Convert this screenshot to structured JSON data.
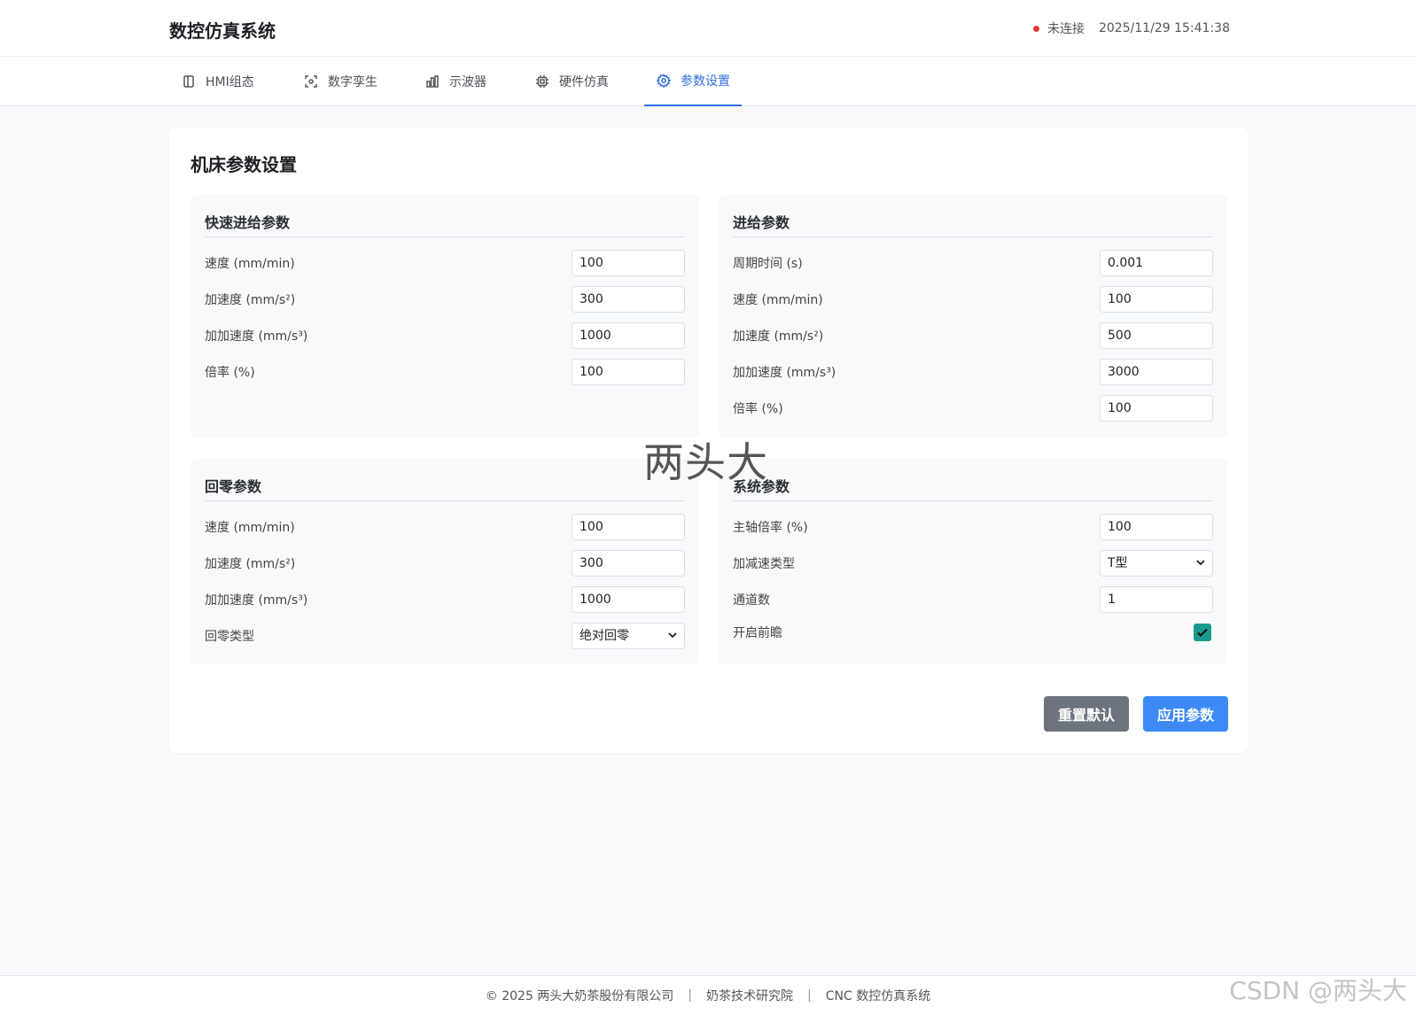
{
  "header": {
    "title": "数控仿真系统",
    "status": "未连接",
    "datetime": "2025/11/29 15:41:38"
  },
  "nav": {
    "tabs": [
      {
        "label": "HMI组态",
        "icon": "layout-icon"
      },
      {
        "label": "数字孪生",
        "icon": "scan-icon"
      },
      {
        "label": "示波器",
        "icon": "bar-chart-icon"
      },
      {
        "label": "硬件仿真",
        "icon": "chip-icon"
      },
      {
        "label": "参数设置",
        "icon": "gear-icon",
        "active": true
      }
    ]
  },
  "card": {
    "title": "机床参数设置",
    "rapid": {
      "title": "快速进给参数",
      "rows": [
        {
          "label": "速度 (mm/min)",
          "value": "100"
        },
        {
          "label": "加速度 (mm/s²)",
          "value": "300"
        },
        {
          "label": "加加速度 (mm/s³)",
          "value": "1000"
        },
        {
          "label": "倍率 (%)",
          "value": "100"
        }
      ]
    },
    "feed": {
      "title": "进给参数",
      "rows": [
        {
          "label": "周期时间 (s)",
          "value": "0.001"
        },
        {
          "label": "速度 (mm/min)",
          "value": "100"
        },
        {
          "label": "加速度 (mm/s²)",
          "value": "500"
        },
        {
          "label": "加加速度 (mm/s³)",
          "value": "3000"
        },
        {
          "label": "倍率 (%)",
          "value": "100"
        }
      ]
    },
    "homing": {
      "title": "回零参数",
      "rows": [
        {
          "label": "速度 (mm/min)",
          "value": "100"
        },
        {
          "label": "加速度 (mm/s²)",
          "value": "300"
        },
        {
          "label": "加加速度 (mm/s³)",
          "value": "1000"
        }
      ],
      "type_label": "回零类型",
      "type_value": "绝对回零"
    },
    "system": {
      "title": "系统参数",
      "spindle_label": "主轴倍率 (%)",
      "spindle_value": "100",
      "accel_type_label": "加减速类型",
      "accel_type_value": "T型",
      "channels_label": "通道数",
      "channels_value": "1",
      "lookahead_label": "开启前瞻",
      "lookahead_checked": true
    },
    "reset_label": "重置默认",
    "apply_label": "应用参数"
  },
  "watermark": "两头大",
  "footer": {
    "copyright": "© 2025 两头大奶茶股份有限公司",
    "sep": "|",
    "institute": "奶茶技术研究院",
    "system": "CNC 数控仿真系统"
  },
  "csdn_mark": "CSDN @两头大",
  "colors": {
    "accent": "#2f6fdf",
    "apply_button": "#3d8af7",
    "reset_button": "#6c747d",
    "status_dot": "#e53935",
    "checkbox": "#1a9a8f"
  }
}
